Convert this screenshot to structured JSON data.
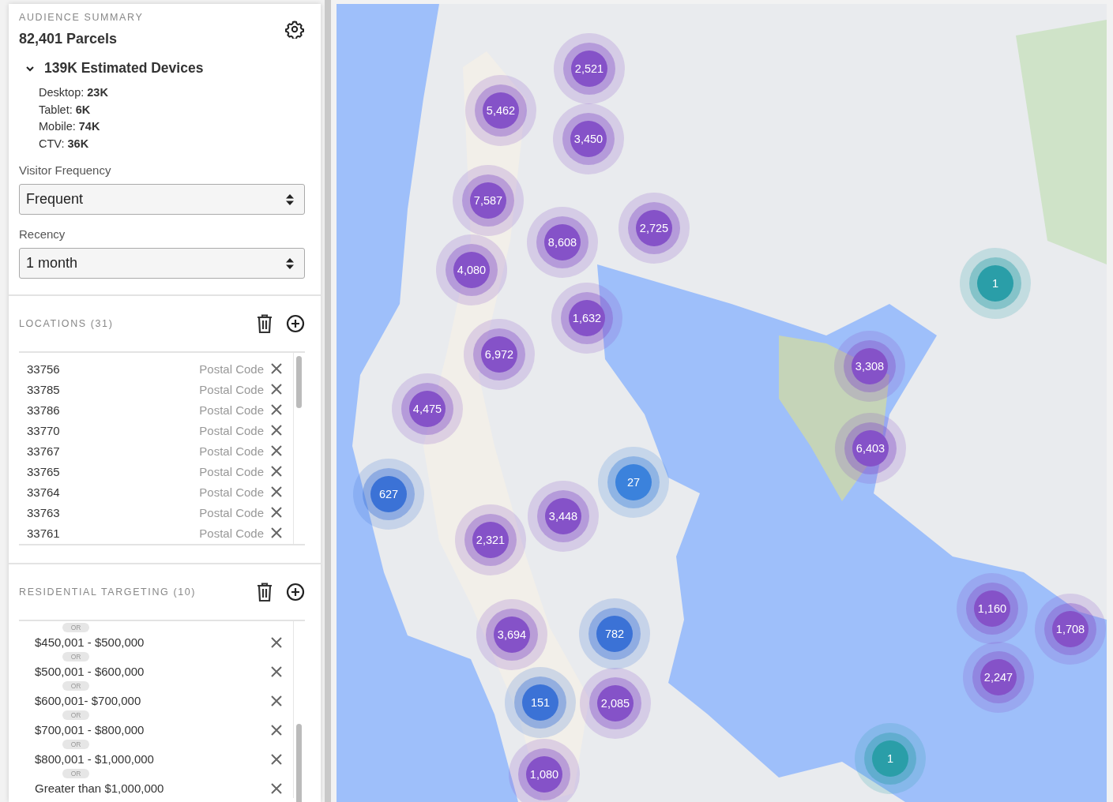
{
  "audience_summary": {
    "heading": "AUDIENCE SUMMARY",
    "parcels": "82,401 Parcels",
    "devices": {
      "label": "139K Estimated Devices",
      "expanded": true,
      "items": [
        "Desktop: **23K**",
        "Tablet: **6K**",
        "Mobile: **74K**",
        "CTV: **36K**"
      ]
    },
    "visitor_frequency": {
      "label": "Visitor Frequency",
      "value": "Frequent"
    },
    "recency": {
      "label": "Recency",
      "value": "1 month"
    }
  },
  "locations": {
    "heading": "LOCATIONS (31)",
    "rows": [
      {
        "code": "33756",
        "type": "Postal Code"
      },
      {
        "code": "33785",
        "type": "Postal Code"
      },
      {
        "code": "33786",
        "type": "Postal Code"
      },
      {
        "code": "33770",
        "type": "Postal Code"
      },
      {
        "code": "33767",
        "type": "Postal Code"
      },
      {
        "code": "33765",
        "type": "Postal Code"
      },
      {
        "code": "33764",
        "type": "Postal Code"
      },
      {
        "code": "33763",
        "type": "Postal Code"
      },
      {
        "code": "33761",
        "type": "Postal Code"
      }
    ]
  },
  "residential_targeting": {
    "heading": "RESIDENTIAL TARGETING (10)",
    "rows": [
      {
        "connector": "OR",
        "label": "$450,001 - $500,000"
      },
      {
        "connector": "OR",
        "label": "$500,001 - $600,000"
      },
      {
        "connector": "OR",
        "label": "$600,001- $700,000"
      },
      {
        "connector": "OR",
        "label": "$700,001 - $800,000"
      },
      {
        "connector": "OR",
        "label": "$800,001 - $1,000,000"
      },
      {
        "connector": "OR",
        "label": "Greater than $1,000,000"
      }
    ]
  },
  "map": {
    "clusters": [
      {
        "count": "2,521",
        "color": "#8552c8"
      },
      {
        "count": "5,462",
        "color": "#8552c8"
      },
      {
        "count": "3,450",
        "color": "#8552c8"
      },
      {
        "count": "7,587",
        "color": "#8552c8"
      },
      {
        "count": "8,608",
        "color": "#8552c8"
      },
      {
        "count": "2,725",
        "color": "#8552c8"
      },
      {
        "count": "4,080",
        "color": "#8552c8"
      },
      {
        "count": "1,632",
        "color": "#8552c8"
      },
      {
        "count": "6,972",
        "color": "#8552c8"
      },
      {
        "count": "4,475",
        "color": "#8552c8"
      },
      {
        "count": "27",
        "color": "#3b82dc"
      },
      {
        "count": "627",
        "color": "#3b72d6"
      },
      {
        "count": "3,448",
        "color": "#8552c8"
      },
      {
        "count": "2,321",
        "color": "#8552c8"
      },
      {
        "count": "3,694",
        "color": "#8552c8"
      },
      {
        "count": "782",
        "color": "#3b72d6"
      },
      {
        "count": "151",
        "color": "#3b72d6"
      },
      {
        "count": "2,085",
        "color": "#8552c8"
      },
      {
        "count": "1,080",
        "color": "#8552c8"
      },
      {
        "count": "1",
        "color": "#2a9ea8"
      },
      {
        "count": "3,308",
        "color": "#8552c8"
      },
      {
        "count": "6,403",
        "color": "#8552c8"
      },
      {
        "count": "1,160",
        "color": "#8552c8"
      },
      {
        "count": "1,708",
        "color": "#8552c8"
      },
      {
        "count": "2,247",
        "color": "#8552c8"
      },
      {
        "count": "1",
        "color": "#2a9ea8"
      }
    ]
  }
}
